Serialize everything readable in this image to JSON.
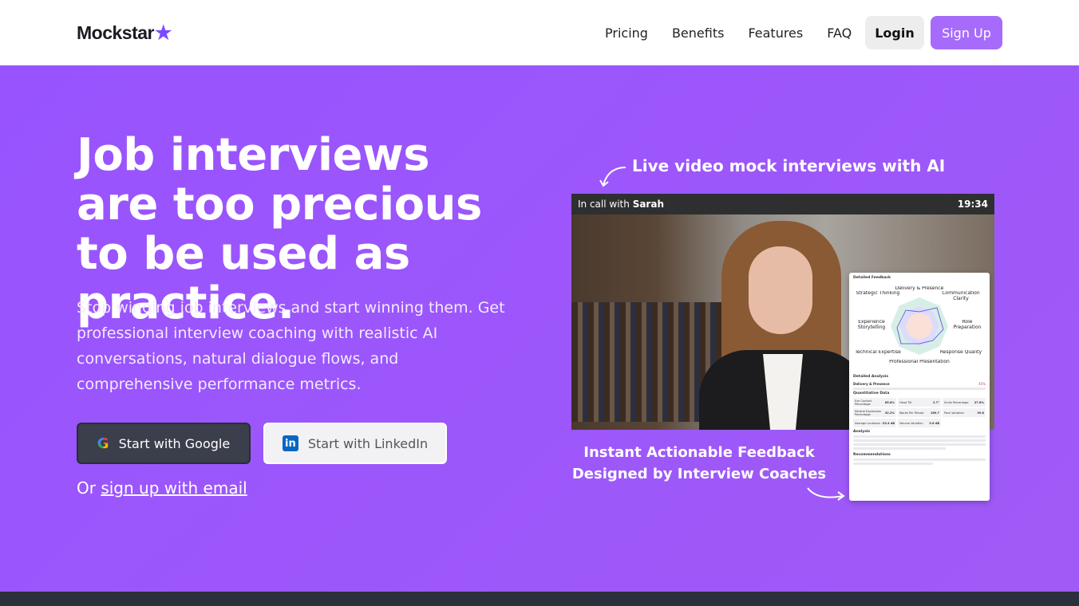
{
  "nav": {
    "logo": "Mockstar",
    "links": [
      "Pricing",
      "Benefits",
      "Features",
      "FAQ"
    ],
    "login": "Login",
    "signup": "Sign Up"
  },
  "hero": {
    "title": "Job interviews are too precious to be used as practice.",
    "subtitle": "Stop winging job interviews and start winning them. Get professional interview coaching with realistic AI conversations, natural dialogue flows, and comprehensive performance metrics.",
    "google_btn": "Start with Google",
    "linkedin_btn": "Start with LinkedIn",
    "or_text": "Or",
    "email_link": "sign up with email"
  },
  "video": {
    "caption": "Live video mock interviews with AI",
    "call_prefix": "In call with",
    "caller": "Sarah",
    "timer": "19:34"
  },
  "feedback": {
    "title": "Detailed Feedback",
    "radar_labels": [
      "Delivery & Presence",
      "Communication Clarity",
      "Role Preparation",
      "Response Quality",
      "Professional Presentation",
      "Technical Expertise",
      "Experience Storytelling",
      "Strategic Thinking"
    ],
    "analysis_title": "Detailed Analysis",
    "section": "Delivery & Presence",
    "score": "45%",
    "quant_title": "Quantitative Data",
    "metrics": [
      [
        "Eye Contact Percentage",
        "65.8%"
      ],
      [
        "Head Tilt",
        "2.7°"
      ],
      [
        "Smile Percentage",
        "27.8%"
      ],
      [
        "Neutral Expression Percentage",
        "32.2%"
      ],
      [
        "Words Per Minute",
        "189.7"
      ],
      [
        "Pace Variation",
        "39.8"
      ],
      [
        "Average Loudness",
        "-23.4 dB"
      ],
      [
        "Volume Variation",
        "5.6 dB"
      ]
    ],
    "analysis_label": "Analysis",
    "recommendations_label": "Recommendations"
  },
  "caption2": "Instant Actionable Feedback Designed by Interview Coaches"
}
